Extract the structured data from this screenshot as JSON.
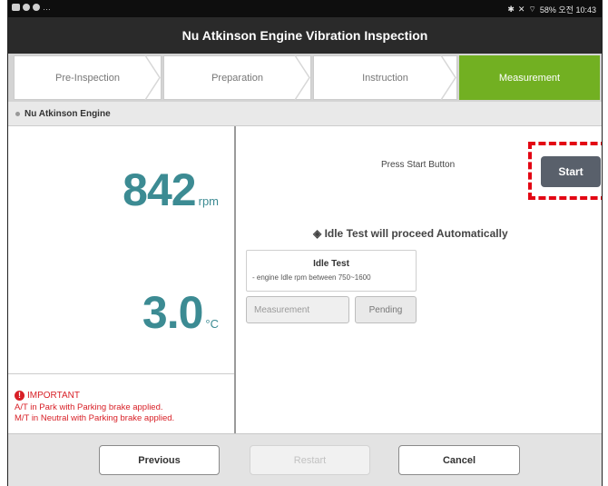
{
  "statusbar": {
    "right_text": "58% 오전 10:43"
  },
  "title": "Nu Atkinson Engine Vibration Inspection",
  "steps": [
    {
      "label": "Pre-Inspection"
    },
    {
      "label": "Preparation"
    },
    {
      "label": "Instruction"
    },
    {
      "label": "Measurement"
    }
  ],
  "section_title": "Nu Atkinson Engine",
  "readings": {
    "rpm_value": "842",
    "rpm_unit": "rpm",
    "temp_value": "3.0",
    "temp_unit": "°C"
  },
  "important": {
    "title": "IMPORTANT",
    "line1": "A/T in Park with Parking brake applied.",
    "line2": "M/T in Neutral with Parking brake applied."
  },
  "measurement": {
    "press_text": "Press Start Button",
    "start_label": "Start",
    "auto_text": "◈ Idle Test will proceed Automatically",
    "idle_title": "Idle Test",
    "idle_desc": "- engine Idle rpm between 750~1600",
    "measurement_label": "Measurement",
    "pending_label": "Pending"
  },
  "buttons": {
    "previous": "Previous",
    "restart": "Restart",
    "cancel": "Cancel"
  },
  "colors": {
    "active_step": "#72b022",
    "reading": "#3c8b93",
    "important": "#d81f26",
    "highlight": "#e30613"
  }
}
